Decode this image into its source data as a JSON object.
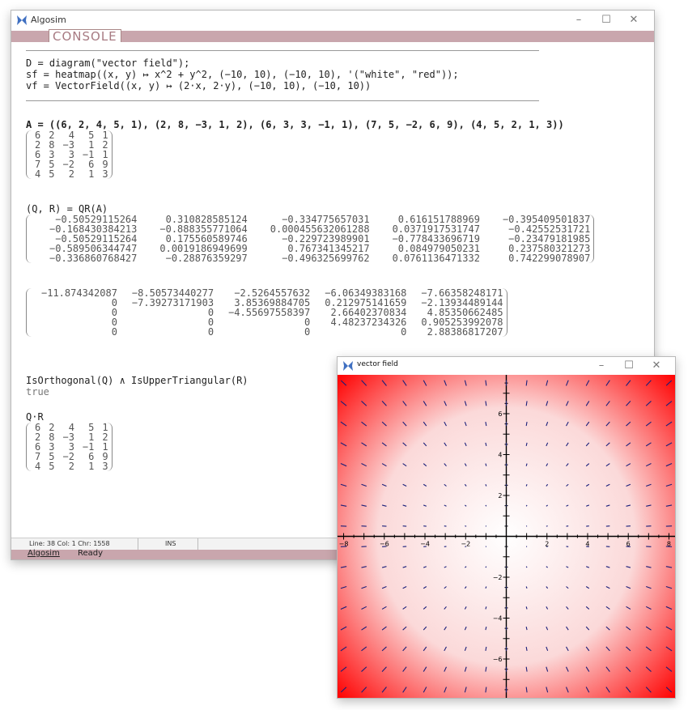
{
  "main_window": {
    "title": "Algosim",
    "console_label": "CONSOLE",
    "controls": {
      "minimize": "–",
      "maximize": "☐",
      "close": "✕"
    }
  },
  "console": {
    "script_lines": [
      "D = diagram(\"vector field\");",
      "sf = heatmap((x, y) ↦ x^2 + y^2, (−10, 10), (−10, 10), '(\"white\", \"red\"));",
      "vf = VectorField((x, y) ↦ (2·x, 2·y), (−10, 10), (−10, 10))"
    ],
    "a_command": "A = ((6, 2, 4, 5, 1), (2, 8, −3, 1, 2), (6, 3, 3, −1, 1), (7, 5, −2, 6, 9), (4, 5, 2, 1, 3))",
    "matrix_a": [
      [
        "6",
        "2",
        "4",
        "5",
        "1"
      ],
      [
        "2",
        "8",
        "−3",
        "1",
        "2"
      ],
      [
        "6",
        "3",
        "3",
        "−1",
        "1"
      ],
      [
        "7",
        "5",
        "−2",
        "6",
        "9"
      ],
      [
        "4",
        "5",
        "2",
        "1",
        "3"
      ]
    ],
    "qr_command": "(Q, R) = QR(A)",
    "matrix_q": [
      [
        "−0.50529115264",
        "0.310828585124",
        "−0.334775657031",
        "0.616151788969",
        "−0.395409501837"
      ],
      [
        "−0.168430384213",
        "−0.888355771064",
        "0.000455632061288",
        "0.0371917531747",
        "−0.42552531721"
      ],
      [
        "−0.50529115264",
        "0.175560589746",
        "−0.229723989901",
        "−0.778433696719",
        "−0.23479181985"
      ],
      [
        "−0.589506344747",
        "0.0019186949699",
        "0.767341345217",
        "0.084979050231",
        "0.237580321273"
      ],
      [
        "−0.336860768427",
        "−0.28876359297",
        "−0.496325699762",
        "0.0761136471332",
        "0.742299078907"
      ]
    ],
    "matrix_r": [
      [
        "−11.874342087",
        "−8.50573440277",
        "−2.5264557632",
        "−6.06349383168",
        "−7.66358248171"
      ],
      [
        "0",
        "−7.39273171903",
        "3.85369884705",
        "0.212975141659",
        "−2.13934489144"
      ],
      [
        "0",
        "0",
        "−4.55697558397",
        "2.66402370834",
        "4.85350662485"
      ],
      [
        "0",
        "0",
        "0",
        "4.48237234326",
        "0.905253992078"
      ],
      [
        "0",
        "0",
        "0",
        "0",
        "2.88386817207"
      ]
    ],
    "check_command": "IsOrthogonal(Q) ∧ IsUpperTriangular(R)",
    "check_result": "true",
    "product_command": "Q·R",
    "matrix_qr": [
      [
        "6",
        "2",
        "4",
        "5",
        "1"
      ],
      [
        "2",
        "8",
        "−3",
        "1",
        "2"
      ],
      [
        "6",
        "3",
        "3",
        "−1",
        "1"
      ],
      [
        "7",
        "5",
        "−2",
        "6",
        "9"
      ],
      [
        "4",
        "5",
        "2",
        "1",
        "3"
      ]
    ]
  },
  "status_bar": {
    "position": "Line: 38  Col: 1  Chr: 1558",
    "mode": "INS",
    "app_menu": "Algosim",
    "state": "Ready"
  },
  "plot_window": {
    "title": "vector field",
    "controls": {
      "minimize": "–",
      "maximize": "☐",
      "close": "✕"
    }
  },
  "chart_data": {
    "type": "vector field with heatmap background",
    "heatmap_function": "x^2 + y^2",
    "heatmap_colors": [
      "#ffffff",
      "#ff0000"
    ],
    "vector_function": "(2·x, 2·y)",
    "arrow_color": "#1a1f7a",
    "xlim": [
      -8.3,
      8.3
    ],
    "ylim": [
      -7.9,
      7.9
    ],
    "x_ticks": [
      -8,
      -6,
      -4,
      -2,
      2,
      4,
      6,
      8
    ],
    "y_ticks": [
      -6,
      -4,
      -2,
      2,
      4,
      6
    ],
    "x_tick_labels": [
      "−8",
      "−6",
      "−4",
      "−2",
      "2",
      "4",
      "6",
      "8"
    ],
    "y_tick_labels": [
      "−6",
      "−4",
      "−2",
      "2",
      "4",
      "6"
    ],
    "grid": false
  }
}
